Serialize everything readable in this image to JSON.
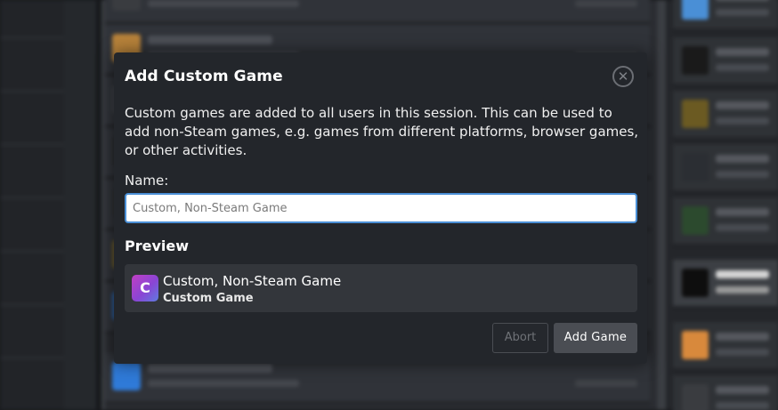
{
  "modal": {
    "title": "Add Custom Game",
    "close_icon": "close-icon",
    "close_glyph": "✕",
    "description": "Custom games are added to all users in this session. This can be used to add non-Steam games, e.g. games from different platforms, browser games, or other activities.",
    "name_label": "Name:",
    "name_placeholder": "Custom, Non-Steam Game",
    "name_value": "",
    "preview_label": "Preview",
    "preview": {
      "avatar_letter": "C",
      "name": "Custom, Non-Steam Game",
      "subtitle": "Custom Game"
    },
    "abort_label": "Abort",
    "add_label": "Add Game"
  },
  "colors": {
    "modal_bg": "#23262b",
    "input_focus_border": "#4a8fd6",
    "primary_button": "#4a4d53",
    "avatar_gradient_start": "#c13fc4",
    "avatar_gradient_end": "#5f7be0"
  }
}
